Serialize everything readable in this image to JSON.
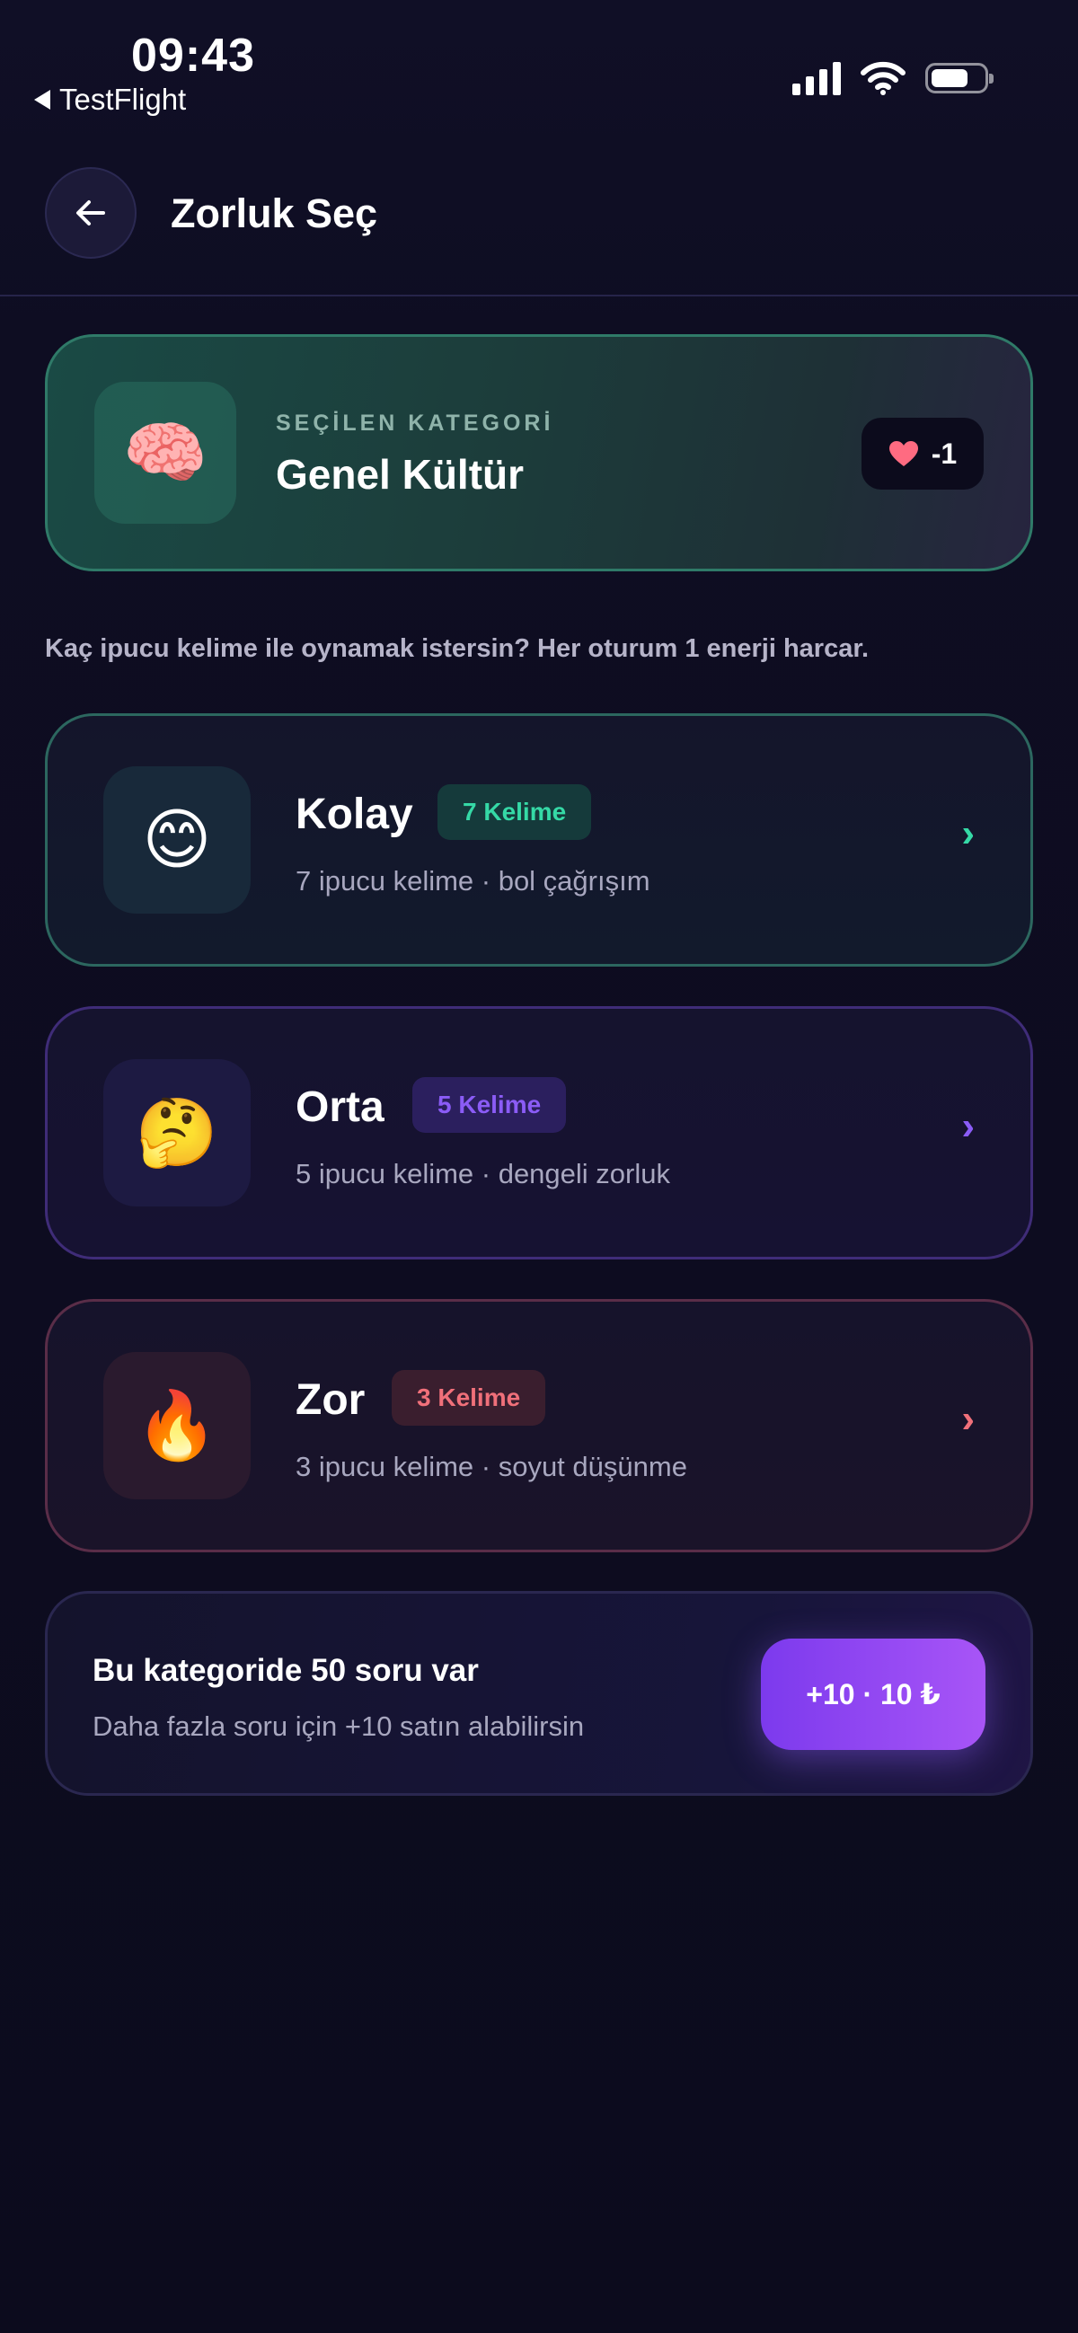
{
  "status_bar": {
    "time": "09:43",
    "back_app": "TestFlight",
    "icons": [
      "signal-icon",
      "wifi-icon",
      "battery-icon"
    ]
  },
  "header": {
    "title": "Zorluk Seç",
    "back_icon": "arrow-left-icon"
  },
  "category": {
    "eyebrow": "SEÇİLEN KATEGORİ",
    "name": "Genel Kültür",
    "emoji": "🧠",
    "energy": "-1",
    "energy_icon": "heart-icon",
    "accent": "#2f7a68"
  },
  "instruction": "Kaç ipucu kelime ile oynamak istersin? Her oturum 1 enerji harcar.",
  "difficulties": [
    {
      "title": "Kolay",
      "badge": "7 Kelime",
      "description": "7 ipucu kelime · bol çağrışım",
      "emoji": "😊",
      "color": "#35d9a6"
    },
    {
      "title": "Orta",
      "badge": "5 Kelime",
      "description": "5 ipucu kelime · dengeli zorluk",
      "emoji": "🤔",
      "color": "#8b5cf6"
    },
    {
      "title": "Zor",
      "badge": "3 Kelime",
      "description": "3 ipucu kelime · soyut düşünme",
      "emoji": "🔥",
      "color": "#f0707a"
    }
  ],
  "purchase": {
    "title": "Bu kategoride 50 soru var",
    "subtitle": "Daha fazla soru için +10 satın alabilirsin",
    "button_label": "+10 · 10 ₺",
    "button_color": "#8b5cf6"
  }
}
